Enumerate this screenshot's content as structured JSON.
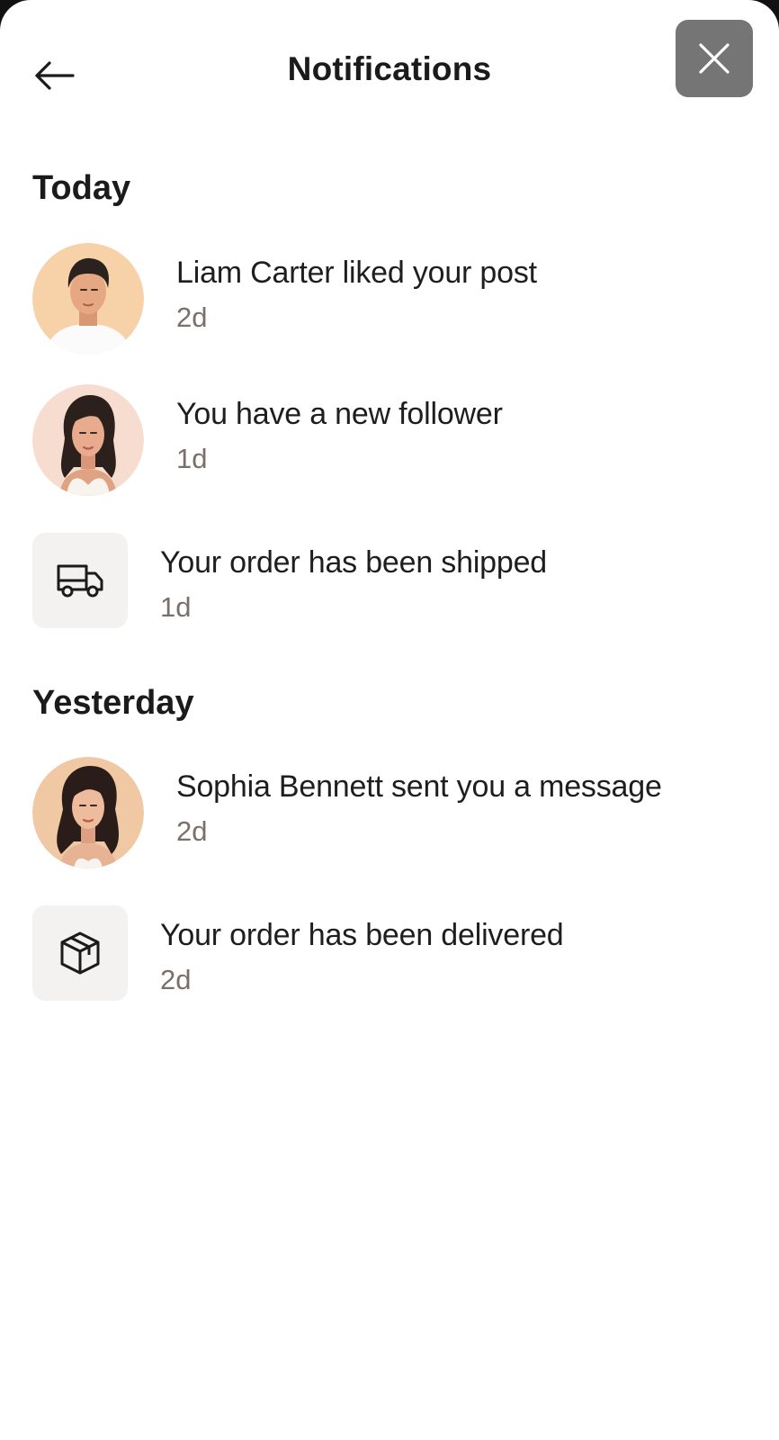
{
  "header": {
    "title": "Notifications",
    "back_icon": "arrow-left-icon",
    "close_icon": "close-icon"
  },
  "sections": [
    {
      "title": "Today",
      "items": [
        {
          "message": "Liam Carter liked your post",
          "time": "2d",
          "icon": "avatar-man"
        },
        {
          "message": "You have a new follower",
          "time": "1d",
          "icon": "avatar-woman"
        },
        {
          "message": "Your order has been shipped",
          "time": "1d",
          "icon": "truck-icon"
        }
      ]
    },
    {
      "title": "Yesterday",
      "items": [
        {
          "message": "Sophia Bennett sent you a message",
          "time": "2d",
          "icon": "avatar-woman-2"
        },
        {
          "message": "Your order has been delivered",
          "time": "2d",
          "icon": "package-icon"
        }
      ]
    }
  ],
  "colors": {
    "close_button_bg": "#757575",
    "tile_bg": "#f3f2f1",
    "time_text": "#7b6f6a"
  }
}
